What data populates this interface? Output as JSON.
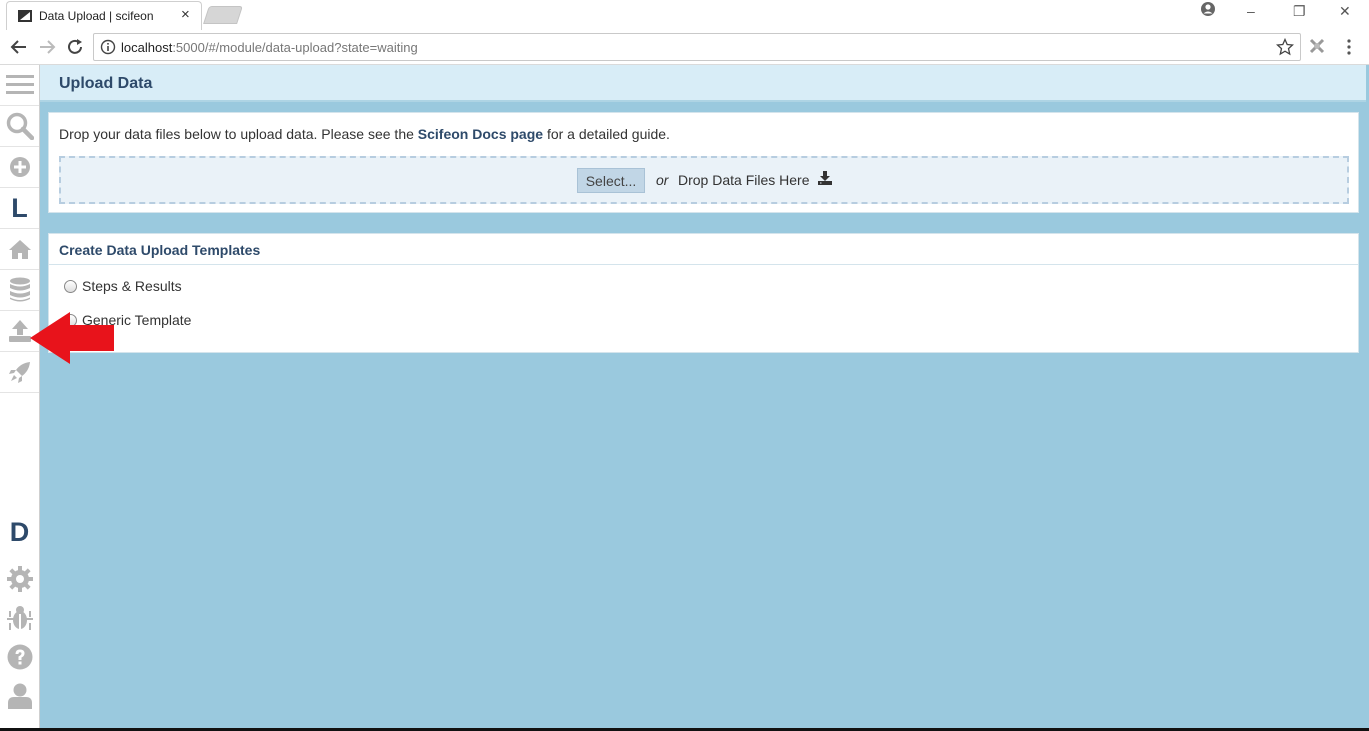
{
  "browser": {
    "tab_title": "Data Upload | scifeon",
    "tab_close": "×",
    "url_host": "localhost",
    "url_path": ":5000/#/module/data-upload?state=waiting",
    "window_controls": {
      "minimize": "–",
      "restore": "❐",
      "close": "✕"
    }
  },
  "sidebar": {
    "items": [
      {
        "name": "menu-icon"
      },
      {
        "name": "search-icon"
      },
      {
        "name": "add-circle-icon"
      },
      {
        "letter": "L"
      },
      {
        "name": "home-icon"
      },
      {
        "name": "database-icon"
      },
      {
        "name": "upload-icon"
      },
      {
        "name": "rocket-icon"
      }
    ],
    "bottom_items": [
      {
        "letter": "D"
      },
      {
        "name": "gear-icon"
      },
      {
        "name": "bug-icon"
      },
      {
        "name": "help-icon"
      },
      {
        "name": "user-icon"
      }
    ]
  },
  "page": {
    "title": "Upload Data",
    "intro_before": "Drop your data files below to upload data. Please see the ",
    "intro_link": "Scifeon Docs page",
    "intro_after": " for a detailed guide.",
    "select_label": "Select...",
    "or_label": "or",
    "drop_label": "Drop Data Files Here"
  },
  "templates": {
    "title": "Create Data Upload Templates",
    "options": [
      "Steps & Results",
      "Generic Template"
    ]
  },
  "colors": {
    "accent": "#2e4a6a",
    "content_bg": "#9ac9de",
    "header_bg": "#d8edf7",
    "annotation_arrow": "#e8131b"
  }
}
